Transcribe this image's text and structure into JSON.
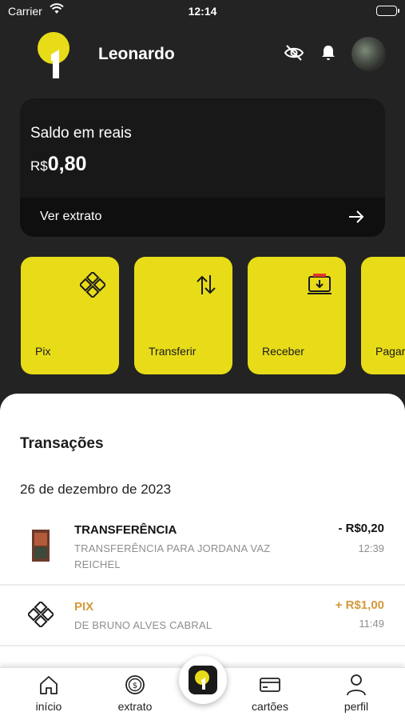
{
  "status_bar": {
    "carrier": "Carrier",
    "time": "12:14"
  },
  "header": {
    "user_name": "Leonardo"
  },
  "balance": {
    "title": "Saldo em reais",
    "currency": "R$",
    "amount": "0,80",
    "statement_label": "Ver extrato"
  },
  "actions": [
    {
      "label": "Pix",
      "icon": "pix-icon"
    },
    {
      "label": "Transferir",
      "icon": "transfer-arrows-icon"
    },
    {
      "label": "Receber",
      "icon": "receive-icon"
    },
    {
      "label": "Pagar",
      "icon": "barcode-icon"
    }
  ],
  "transactions": {
    "heading": "Transações",
    "date": "26 de dezembro de 2023",
    "items": [
      {
        "title": "TRANSFERÊNCIA",
        "description": "TRANSFERÊNCIA PARA JORDANA VAZ REICHEL",
        "amount": "- R$0,20",
        "time": "12:39",
        "title_color": "#111111",
        "amount_color": "#111111"
      },
      {
        "title": "PIX",
        "description": "DE BRUNO ALVES CABRAL",
        "amount": "+ R$1,00",
        "time": "11:49",
        "title_color": "#d39a3a",
        "amount_color": "#d39a3a"
      }
    ]
  },
  "bottom_nav": {
    "items": [
      {
        "label": "início",
        "icon": "home-icon"
      },
      {
        "label": "extrato",
        "icon": "statement-coin-icon"
      },
      {
        "label": "cartões",
        "icon": "card-icon"
      },
      {
        "label": "perfil",
        "icon": "user-icon"
      }
    ]
  },
  "colors": {
    "accent": "#e8dc19",
    "background": "#232323",
    "income": "#d39a3a"
  }
}
